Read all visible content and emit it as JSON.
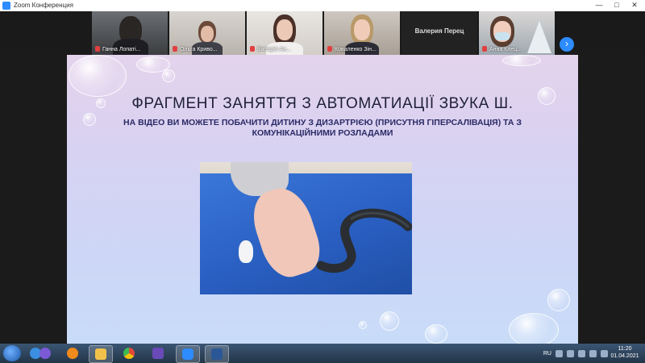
{
  "window": {
    "title": "Zoom Конференция",
    "controls": {
      "minimize": "—",
      "maximize": "□",
      "close": "✕"
    }
  },
  "participants": [
    {
      "name": "Ганна Лопаті...",
      "muted": true
    },
    {
      "name": "Ольга Криво...",
      "muted": true
    },
    {
      "name": "Вікторія Ан...",
      "muted": true
    },
    {
      "name": "Коваленко Зін...",
      "muted": true
    },
    {
      "name": "Валерия Перец",
      "muted": false,
      "video": false
    },
    {
      "name": "Анна Клец...",
      "muted": true
    }
  ],
  "next_page_icon": "chevron-right-icon",
  "slide": {
    "title": "ФРАГМЕНТ ЗАНЯТТЯ З АВТОМАТИАЦІЇ ЗВУКА Ш.",
    "subtitle": "НА ВІДЕО ВИ МОЖЕТЕ ПОБАЧИТИ ДИТИНУ З ДИЗАРТРІЄЮ (ПРИСУТНЯ ГІПЕРСАЛІВАЦІЯ) ТА З КОМУНІКАЦІЙНИМИ РОЗЛАДАМИ"
  },
  "taskbar": {
    "items": [
      "start-orb",
      "ie-icon",
      "viber-icon",
      "media-player-icon",
      "explorer-icon",
      "chrome-icon",
      "save-icon",
      "zoom-icon",
      "word-icon"
    ],
    "tray_lang": "RU",
    "time": "11:20",
    "date": "01.04.2021"
  },
  "colors": {
    "zoom_blue": "#2d8cff",
    "mute_red": "#e04040",
    "slide_text": "#2a2a66"
  }
}
